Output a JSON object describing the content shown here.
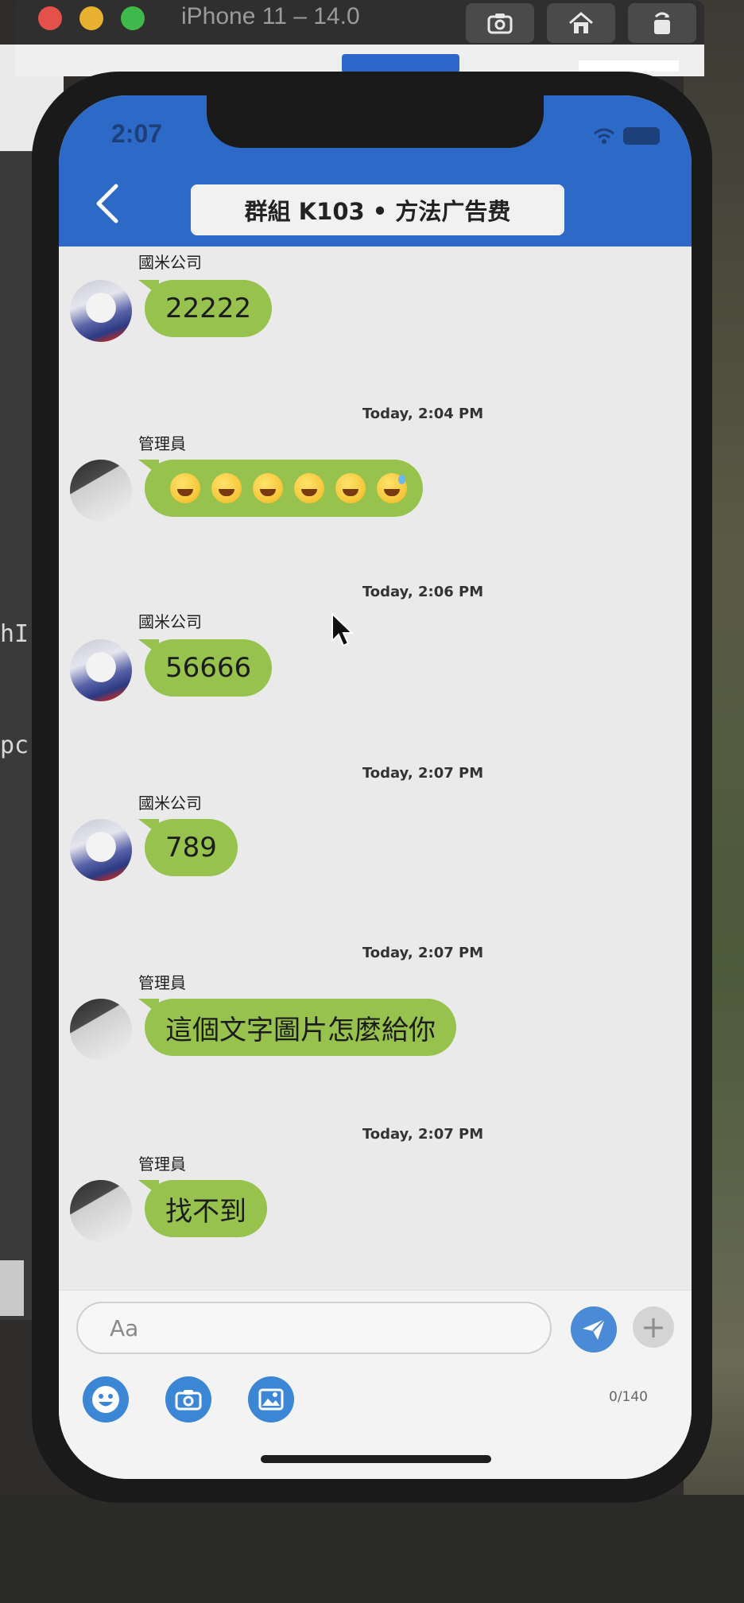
{
  "simulator": {
    "title": "iPhone 11 – 14.0",
    "buttons": [
      "screenshot-icon",
      "home-icon",
      "rotate-icon"
    ]
  },
  "background": {
    "left_text_1": "hI",
    "left_text_2": "pc"
  },
  "status_bar": {
    "time": "2:07"
  },
  "header": {
    "title": "群組 K103 • 方法广告费",
    "back_icon": "chevron-left-icon",
    "colors": {
      "header": "#2d69c6",
      "bubble": "#96c24d"
    }
  },
  "messages": [
    {
      "timestamp": "",
      "sender": "國米公司",
      "avatar": "shoe",
      "text": "22222"
    },
    {
      "timestamp": "Today, 2:04 PM",
      "sender": "管理員",
      "avatar": "laptop",
      "text": "",
      "emojis": [
        "grinning",
        "grinning",
        "grinning",
        "grinning",
        "grin",
        "sweat-smile"
      ]
    },
    {
      "timestamp": "Today, 2:06 PM",
      "sender": "國米公司",
      "avatar": "shoe",
      "text": "56666"
    },
    {
      "timestamp": "Today, 2:07 PM",
      "sender": "國米公司",
      "avatar": "shoe",
      "text": "789"
    },
    {
      "timestamp": "Today, 2:07 PM",
      "sender": "管理員",
      "avatar": "laptop",
      "text": "這個文字圖片怎麼給你"
    },
    {
      "timestamp": "Today, 2:07 PM",
      "sender": "管理員",
      "avatar": "laptop",
      "text": "找不到"
    }
  ],
  "composer": {
    "placeholder": "Aa",
    "counter": "0/140",
    "send_icon": "paper-plane-icon",
    "add_icon": "plus-icon",
    "tools": [
      "emoji-icon",
      "camera-icon",
      "image-icon"
    ]
  }
}
